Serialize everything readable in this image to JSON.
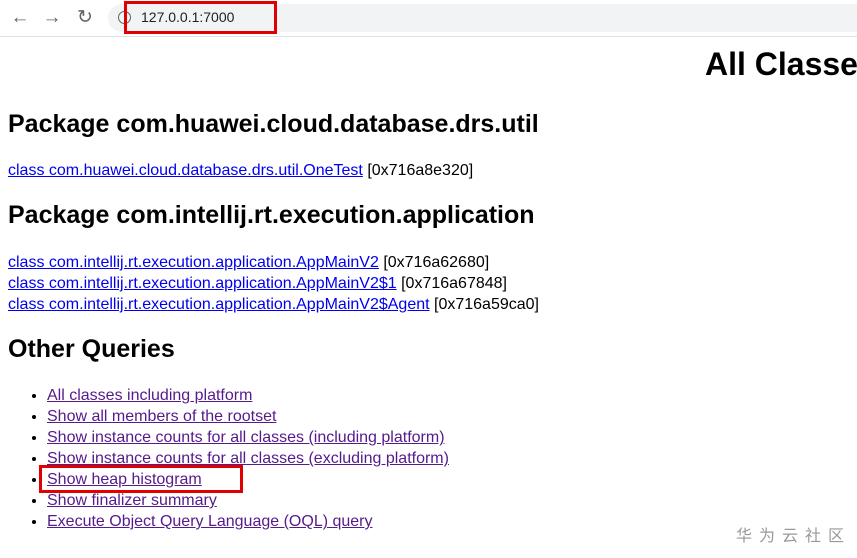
{
  "browser": {
    "url": "127.0.0.1:7000",
    "back_icon": "arrow-left-icon",
    "forward_icon": "arrow-right-icon",
    "reload_icon": "reload-icon",
    "info_icon": "info-icon"
  },
  "page": {
    "title": "All Classe",
    "packages": [
      {
        "heading": "Package com.huawei.cloud.database.drs.util",
        "classes": [
          {
            "link": "class com.huawei.cloud.database.drs.util.OneTest",
            "addr": "[0x716a8e320]"
          }
        ]
      },
      {
        "heading": "Package com.intellij.rt.execution.application",
        "classes": [
          {
            "link": "class com.intellij.rt.execution.application.AppMainV2",
            "addr": "[0x716a62680]"
          },
          {
            "link": "class com.intellij.rt.execution.application.AppMainV2$1",
            "addr": "[0x716a67848]"
          },
          {
            "link": "class com.intellij.rt.execution.application.AppMainV2$Agent",
            "addr": "[0x716a59ca0]"
          }
        ]
      }
    ],
    "other_heading": "Other Queries",
    "queries": [
      "All classes including platform",
      "Show all members of the rootset",
      "Show instance counts for all classes (including platform)",
      "Show instance counts for all classes (excluding platform)",
      "Show heap histogram",
      "Show finalizer summary",
      "Execute Object Query Language (OQL) query"
    ]
  },
  "annotation_color": "#e00000",
  "watermark": "华为云社区"
}
